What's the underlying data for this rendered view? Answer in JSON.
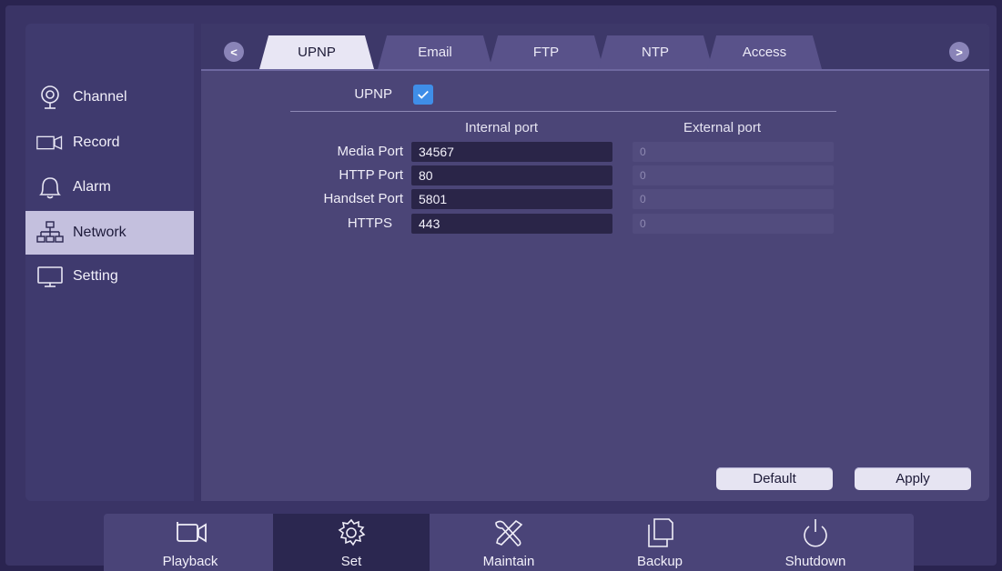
{
  "sidebar": {
    "items": [
      {
        "label": "Channel",
        "icon": "channel-icon"
      },
      {
        "label": "Record",
        "icon": "record-icon"
      },
      {
        "label": "Alarm",
        "icon": "alarm-bell-icon"
      },
      {
        "label": "Network",
        "icon": "network-icon",
        "active": true
      },
      {
        "label": "Setting",
        "icon": "monitor-icon"
      }
    ]
  },
  "tabs": {
    "prev": "<",
    "next": ">",
    "items": [
      "UPNP",
      "Email",
      "FTP",
      "NTP",
      "Access"
    ],
    "active": "UPNP"
  },
  "upnp": {
    "label": "UPNP",
    "checked": true,
    "internal_header": "Internal port",
    "external_header": "External port",
    "rows": [
      {
        "label": "Media Port",
        "internal": "34567",
        "external": "0"
      },
      {
        "label": "HTTP Port",
        "internal": "80",
        "external": "0"
      },
      {
        "label": "Handset Port",
        "internal": "5801",
        "external": "0"
      },
      {
        "label": "HTTPS",
        "internal": "443",
        "external": "0"
      }
    ]
  },
  "buttons": {
    "default": "Default",
    "apply": "Apply"
  },
  "bottom": {
    "items": [
      {
        "label": "Playback",
        "icon": "camera-icon"
      },
      {
        "label": "Set",
        "icon": "gear-icon",
        "active": true
      },
      {
        "label": "Maintain",
        "icon": "tools-icon"
      },
      {
        "label": "Backup",
        "icon": "copy-icon"
      },
      {
        "label": "Shutdown",
        "icon": "power-icon"
      }
    ]
  },
  "colors": {
    "accent": "#3f8ee8",
    "active_tab": "#e8e6f4",
    "panel": "#4b4577"
  }
}
